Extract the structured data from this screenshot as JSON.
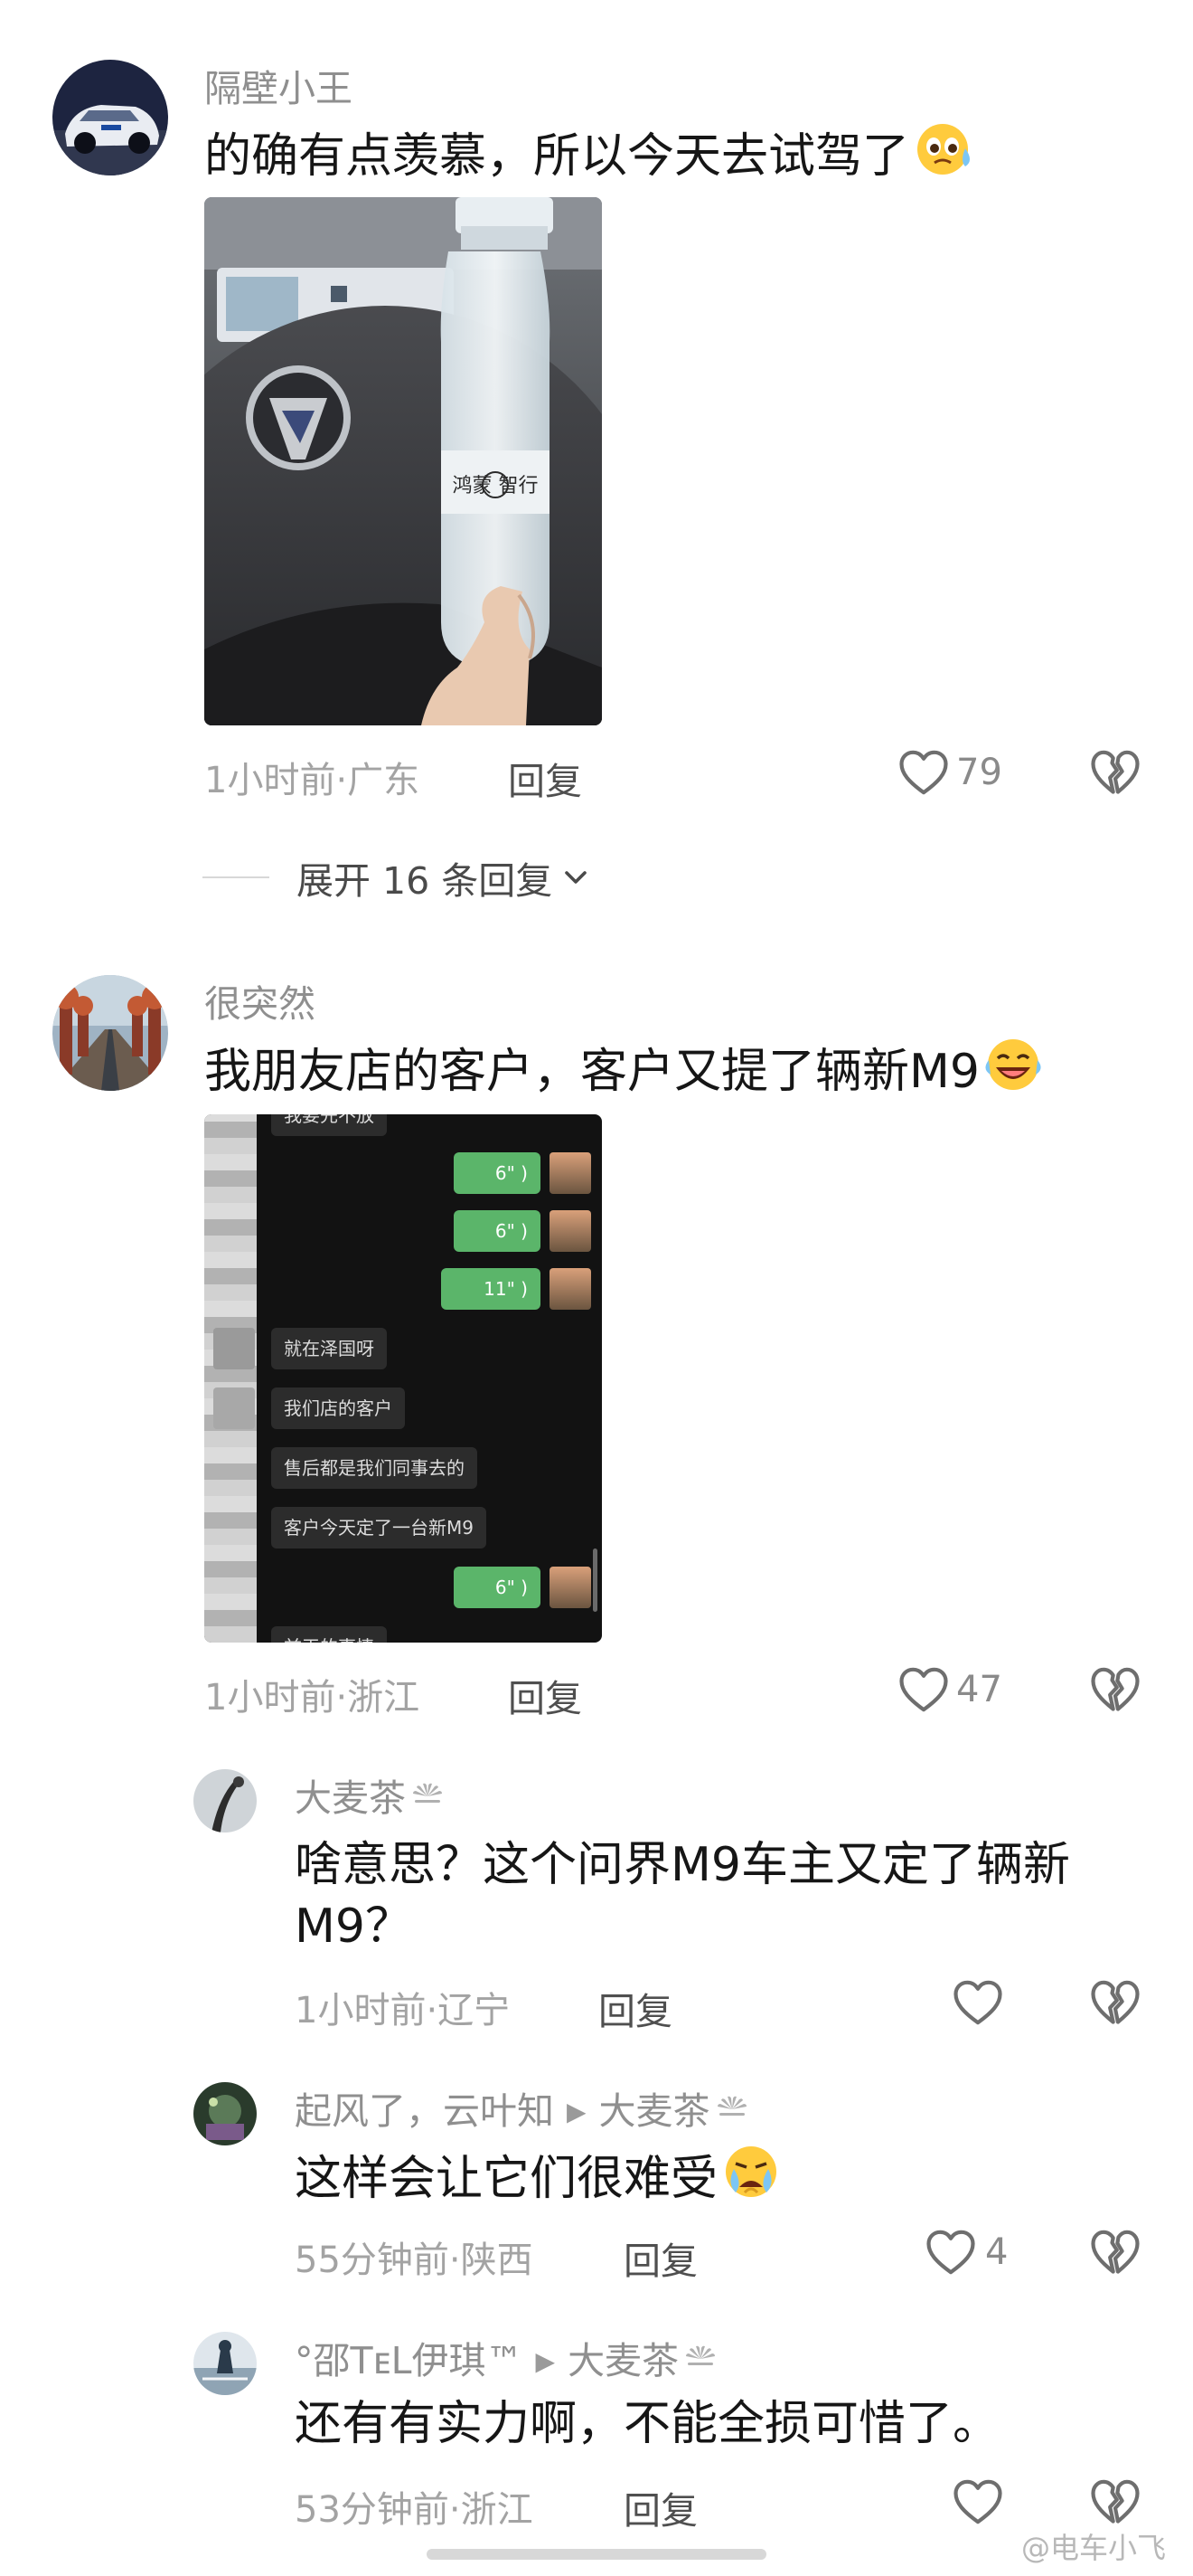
{
  "comments": [
    {
      "username": "隔壁小王",
      "text": "的确有点羡慕，所以今天去试驾了",
      "emoji_icon": "pleading-face-emoji",
      "photo": {
        "bottle_label": "鸿蒙 智行"
      },
      "time_location": "1小时前·广东",
      "reply_label": "回复",
      "likes": "79"
    },
    {
      "username": "很突然",
      "text": "我朋友店的客户，客户又提了辆新M9",
      "emoji_icon": "laughing-crying-emoji",
      "chat": {
        "top_fragment": "我要先不放",
        "voice_1": "6\"",
        "voice_2": "6\"",
        "voice_3": "11\"",
        "msg_1": "就在泽国呀",
        "msg_2": "我们店的客户",
        "msg_3": "售后都是我们同事去的",
        "msg_4": "客户今天定了一台新M9",
        "voice_4": "6\"",
        "bottom_fragment": "前天的事情"
      },
      "time_location": "1小时前·浙江",
      "reply_label": "回复",
      "likes": "47"
    }
  ],
  "expand_replies": "展开 16 条回复",
  "replies": [
    {
      "username": "大麦茶",
      "text_line1": "啥意思？这个问界M9车主又定了辆新",
      "text_line2": "M9？",
      "time_location": "1小时前·辽宁",
      "reply_label": "回复",
      "likes": ""
    },
    {
      "username": "起风了，云叶知",
      "reply_to": "大麦茶",
      "text": "这样会让它们很难受",
      "emoji_icon": "crying-face-emoji",
      "time_location": "55分钟前·陕西",
      "reply_label": "回复",
      "likes": "4"
    },
    {
      "username": "°邵TᴇL伊琪™",
      "reply_to": "大麦茶",
      "text": "还有有实力啊，不能全损可惜了。",
      "time_location": "53分钟前·浙江",
      "reply_label": "回复",
      "likes": ""
    }
  ],
  "watermark": "@电车小飞",
  "colors": {
    "text": "#161616",
    "meta": "#a3a3a3",
    "wechat_green": "#5bb56a"
  }
}
